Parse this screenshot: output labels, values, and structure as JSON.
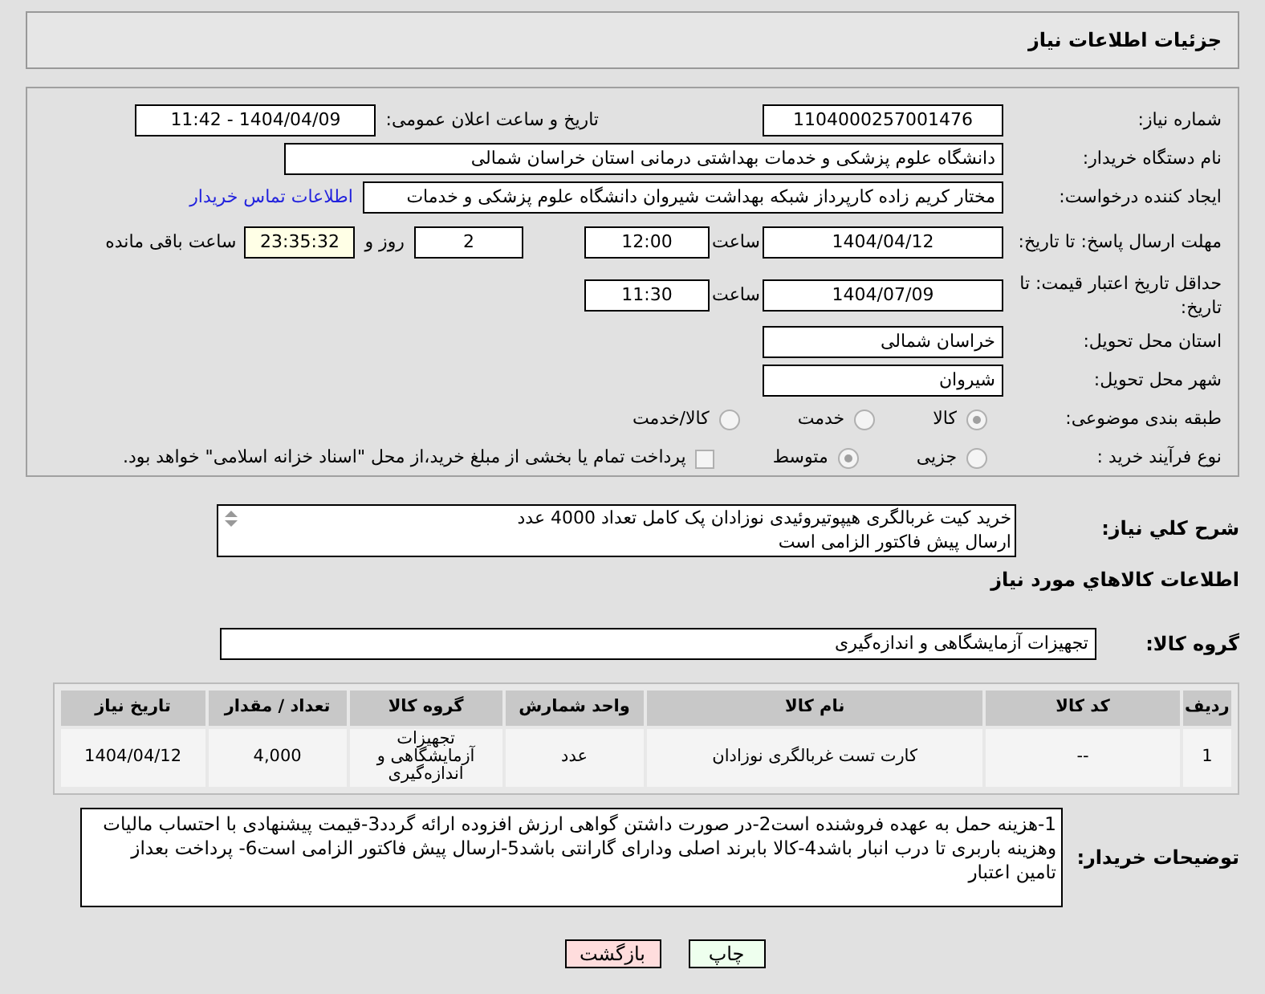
{
  "header": {
    "title": "جزئیات اطلاعات نیاز"
  },
  "need_number": {
    "label": "شماره نیاز:",
    "value": "1104000257001476"
  },
  "announce": {
    "label": "تاریخ و ساعت اعلان عمومی:",
    "value": "1404/04/09 - 11:42"
  },
  "buyer_org": {
    "label": "نام دستگاه خریدار:",
    "value": "دانشگاه علوم پزشکی و خدمات بهداشتی درمانی استان خراسان شمالی"
  },
  "requester": {
    "label": "ایجاد کننده درخواست:",
    "value": "مختار کریم زاده کارپرداز شبکه بهداشت شیروان دانشگاه علوم پزشکی و خدمات",
    "link": "اطلاعات تماس خریدار"
  },
  "deadline": {
    "label": "مهلت ارسال پاسخ: تا تاریخ:",
    "date": "1404/04/12",
    "time_label": "ساعت",
    "time": "12:00",
    "days": "2",
    "days_label": "روز و",
    "remaining": "23:35:32",
    "remaining_label": "ساعت باقی مانده"
  },
  "validity": {
    "label": "حداقل تاریخ اعتبار قیمت: تا تاریخ:",
    "date": "1404/07/09",
    "time_label": "ساعت",
    "time": "11:30"
  },
  "province": {
    "label": "استان محل تحویل:",
    "value": "خراسان شمالی"
  },
  "city": {
    "label": "شهر محل تحویل:",
    "value": "شیروان"
  },
  "category": {
    "label": "طبقه بندی موضوعی:",
    "options": [
      {
        "label": "کالا",
        "selected": true
      },
      {
        "label": "خدمت",
        "selected": false
      },
      {
        "label": "کالا/خدمت",
        "selected": false
      }
    ]
  },
  "process": {
    "label": "نوع فرآیند خرید :",
    "options": [
      {
        "label": "جزیی",
        "selected": false
      },
      {
        "label": "متوسط",
        "selected": true
      }
    ],
    "payment": {
      "checked": false,
      "text": "پرداخت تمام یا بخشی از مبلغ خرید،از محل \"اسناد خزانه اسلامی\" خواهد بود."
    }
  },
  "description": {
    "label": "شرح کلي نياز:",
    "lines": [
      "خرید کیت غربالگری هیپوتیروئیدی نوزادان پک کامل تعداد 4000 عدد",
      "ارسال پیش فاکتور الزامی است"
    ]
  },
  "goods_section": {
    "title": "اطلاعات کالاهاي مورد نياز"
  },
  "goods_group": {
    "label": "گروه کالا:",
    "value": "تجهیزات آزمایشگاهی و اندازه‌گیری"
  },
  "table": {
    "columns": [
      "ردیف",
      "کد کالا",
      "نام کالا",
      "واحد شمارش",
      "گروه کالا",
      "تعداد / مقدار",
      "تاریخ نیاز"
    ],
    "rows": [
      [
        "1",
        "--",
        "کارت تست غربالگری نوزادان",
        "عدد",
        "تجهیزات آزمایشگاهی و اندازه‌گیری",
        "4,000",
        "1404/04/12"
      ]
    ]
  },
  "buyer_notes": {
    "label": "توضیحات خریدار:",
    "value": "1-هزینه حمل به عهده فروشنده است2-در صورت داشتن گواهی ارزش افزوده ارائه گردد3-قیمت پیشنهادی با احتساب مالیات وهزینه باربری تا درب انبار  باشد4-کالا بابرند اصلی ودارای گارانتی باشد5-ارسال پیش فاکتور الزامی است6- پرداخت بعداز تامین اعتبار"
  },
  "buttons": [
    {
      "label": "چاپ",
      "kind": "print"
    },
    {
      "label": "بازگشت",
      "kind": "back"
    }
  ]
}
